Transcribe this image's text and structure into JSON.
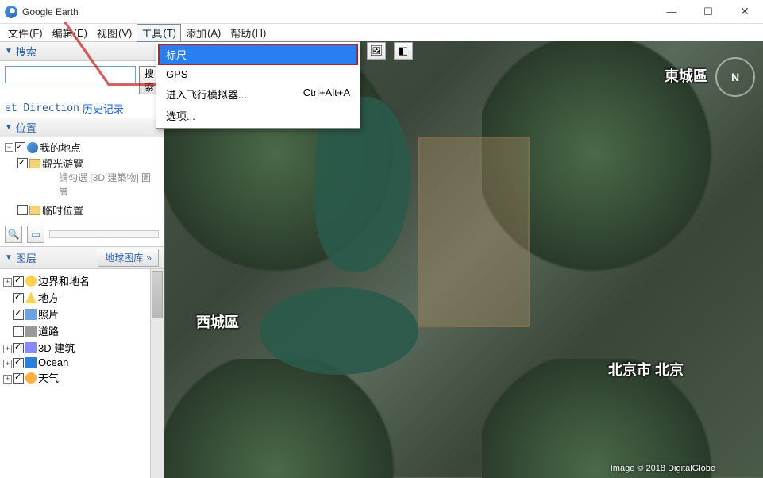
{
  "title": "Google Earth",
  "window": {
    "min": "—",
    "max": "☐",
    "close": "✕"
  },
  "menu": {
    "file": {
      "label": "文件",
      "hot": "(F)"
    },
    "edit": {
      "label": "编辑",
      "hot": "(E)"
    },
    "view": {
      "label": "视图",
      "hot": "(V)"
    },
    "tools": {
      "label": "工具",
      "hot": "(T)"
    },
    "add": {
      "label": "添加",
      "hot": "(A)"
    },
    "help": {
      "label": "帮助",
      "hot": "(H)"
    }
  },
  "tools_menu": {
    "ruler": "标尺",
    "gps": "GPS",
    "flight": "进入飞行模拟器...",
    "flight_hot": "Ctrl+Alt+A",
    "options": "选项..."
  },
  "search": {
    "panel": "搜索",
    "btn": "搜索",
    "placeholder": "",
    "caption_left": "et Direction",
    "caption_right": "历史记录"
  },
  "places": {
    "panel": "位置",
    "root": "我的地点",
    "sight": "觀光游覽",
    "hint": "請勾選 [3D 建築物] 圖層",
    "temp": "临时位置"
  },
  "layers": {
    "panel": "图层",
    "gallery": "地球图库",
    "items": {
      "border": "边界和地名",
      "places": "地方",
      "photo": "照片",
      "road": "道路",
      "bld": "3D 建筑",
      "ocean": "Ocean",
      "weather": "天气"
    }
  },
  "map": {
    "label_xicheng": "西城區",
    "label_dongcheng": "東城區",
    "label_beijing": "北京市 北京",
    "compass": "N",
    "credit": "Image © 2018 DigitalGlobe"
  }
}
